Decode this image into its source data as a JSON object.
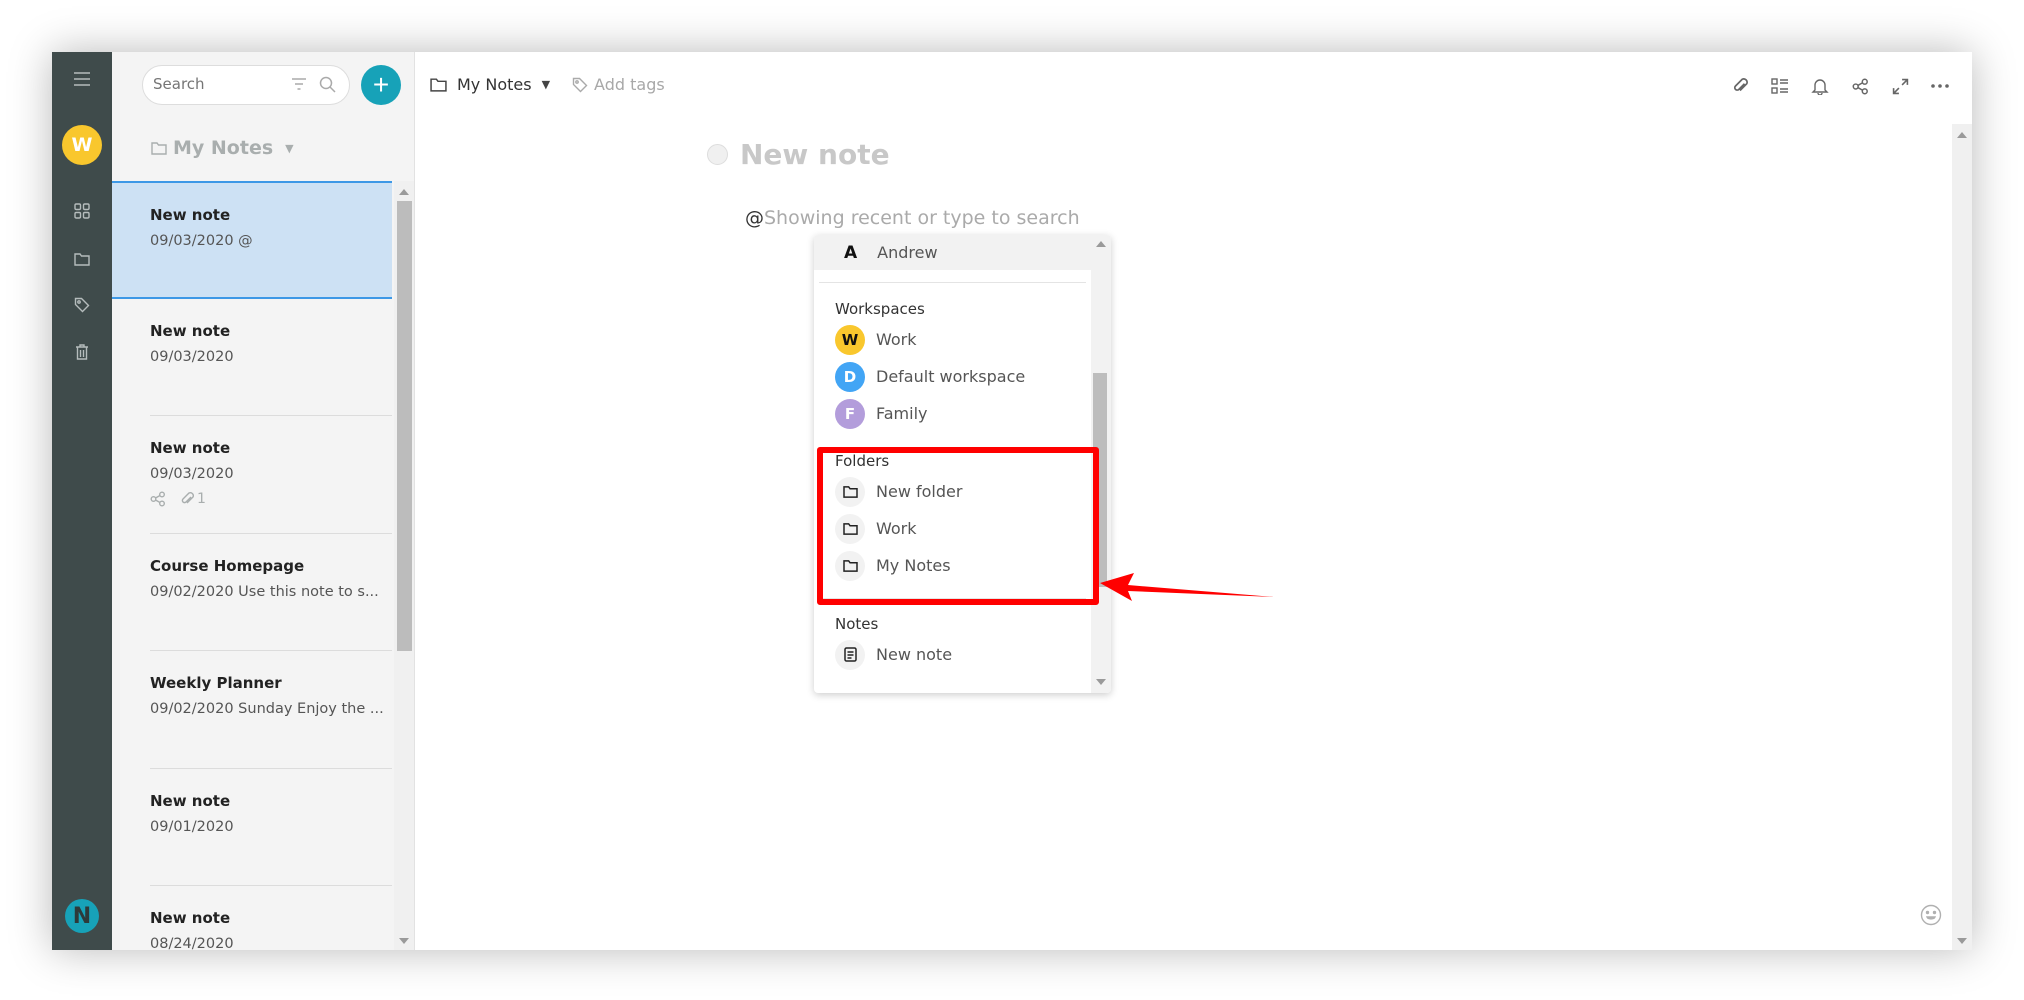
{
  "rail": {
    "menu_icon": "hamburger-menu-icon",
    "workspace_initial": "W",
    "workspace_color": "#f9c72d",
    "nav_icons": [
      "grid-icon",
      "folder-icon",
      "tag-icon",
      "trash-icon"
    ],
    "logo_letter": "N"
  },
  "list": {
    "search_placeholder": "Search",
    "add_label": "+",
    "folder_title": "My Notes",
    "notes": [
      {
        "title": "New note",
        "subtitle": "09/03/2020 @",
        "active": true
      },
      {
        "title": "New note",
        "subtitle": "09/03/2020"
      },
      {
        "title": "New note",
        "subtitle": "09/03/2020",
        "attachments": "1",
        "shared": true
      },
      {
        "title": "Course Homepage",
        "subtitle": "09/02/2020 Use this note to s..."
      },
      {
        "title": "Weekly Planner",
        "subtitle": "09/02/2020 Sunday Enjoy the ..."
      },
      {
        "title": "New note",
        "subtitle": "09/01/2020"
      },
      {
        "title": "New note",
        "subtitle": "08/24/2020"
      }
    ]
  },
  "editor": {
    "folder": "My Notes",
    "add_tags": "Add tags",
    "toolbar_icons": [
      "attachment-icon",
      "checklist-icon",
      "bell-icon",
      "share-icon",
      "expand-icon",
      "more-icon"
    ],
    "note_title": "New note",
    "mention_at": "@",
    "mention_hint": "Showing recent or type to search"
  },
  "dropdown": {
    "user": {
      "initial": "A",
      "name": "Andrew"
    },
    "workspaces_heading": "Workspaces",
    "workspaces": [
      {
        "initial": "W",
        "name": "Work",
        "color": "#f9c72d",
        "text_color": "#111111"
      },
      {
        "initial": "D",
        "name": "Default workspace",
        "color": "#42a5f5",
        "text_color": "#ffffff"
      },
      {
        "initial": "F",
        "name": "Family",
        "color": "#b39ddb",
        "text_color": "#ffffff"
      }
    ],
    "folders_heading": "Folders",
    "folders": [
      "New folder",
      "Work",
      "My Notes"
    ],
    "notes_heading": "Notes",
    "notes": [
      "New note"
    ]
  },
  "annotation": {
    "color": "#ff0000"
  }
}
